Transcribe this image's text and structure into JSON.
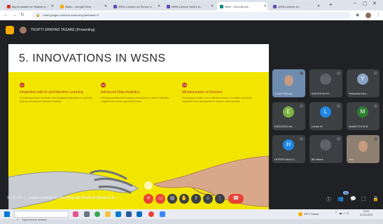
{
  "browser": {
    "tabs": [
      {
        "label": "Big Annotated on Rajesh (s...",
        "color": "#d93025",
        "active": false
      },
      {
        "label": "Radio - Google Drive",
        "color": "#f9ab00",
        "active": false
      },
      {
        "label": "WSN: Lecture on Sensor s...",
        "color": "#5f4bb6",
        "active": false
      },
      {
        "label": "WSN-Lecture Series In...",
        "color": "#5f4bb6",
        "active": false
      },
      {
        "label": "Meet - Gen-rslt-my...",
        "color": "#00897b",
        "active": true
      },
      {
        "label": "WSN-Lecture on...",
        "color": "#5f4bb6",
        "active": false
      }
    ],
    "new_tab": "+",
    "url": "meet.google.com/one-odnw-ang?authuser=0"
  },
  "meet": {
    "presenter": "TRUPTI SHRIPAD TAGARE (Presenting)",
    "slide": {
      "title": "5. INNOVATIONS IN WSNS",
      "columns": [
        {
          "num": "01",
          "heading": "Integration with AI and Machine Learning",
          "body": "Combining sensor networks with intelligent algorithms to optimize data processing and decision making."
        },
        {
          "num": "02",
          "heading": "Advanced Data Analytics",
          "body": "Utilizing sophisticated analytics techniques to derive valuable insights from sensor-generated data."
        },
        {
          "num": "03",
          "heading": "Miniaturization of Sensors",
          "body": "Developing smaller, more efficient sensors to enable seamless integration and deployment in various environments."
        }
      ]
    },
    "participants": [
      {
        "name": "Trupti Shripad...",
        "initial": "",
        "color": "#6d8cb0",
        "video": true
      },
      {
        "name": "ENGGKOLHY...",
        "initial": "",
        "color": "#5f6368",
        "video": false
      },
      {
        "name": "Yelashika Mur...",
        "initial": "Y",
        "color": "#8aa4c8",
        "video": false
      },
      {
        "name": "ENGGKOLHA...",
        "initial": "E",
        "color": "#7cb342",
        "video": false
      },
      {
        "name": "Lahari M",
        "initial": "L",
        "color": "#1e88e5",
        "video": false
      },
      {
        "name": "MAMOTHI M B",
        "initial": "M",
        "color": "#2e7d32",
        "video": false
      },
      {
        "name": "HITESH MALLC...",
        "initial": "H",
        "color": "#1e88e5",
        "video": false
      },
      {
        "name": "89 others",
        "initial": "",
        "color": "#5f6368",
        "video": false
      },
      {
        "name": "You",
        "initial": "",
        "color": "#8d8070",
        "video": true
      }
    ],
    "bottom": {
      "time": "11:01 AM",
      "meeting_title": "Guest Lecture on Unveiling the World of Wireless S...",
      "participant_count": "95"
    }
  },
  "taskbar": {
    "search_placeholder": "Type here to search",
    "weather": "29°C Sunny",
    "clock_time": "11:01",
    "clock_date": "01-03-2024"
  }
}
